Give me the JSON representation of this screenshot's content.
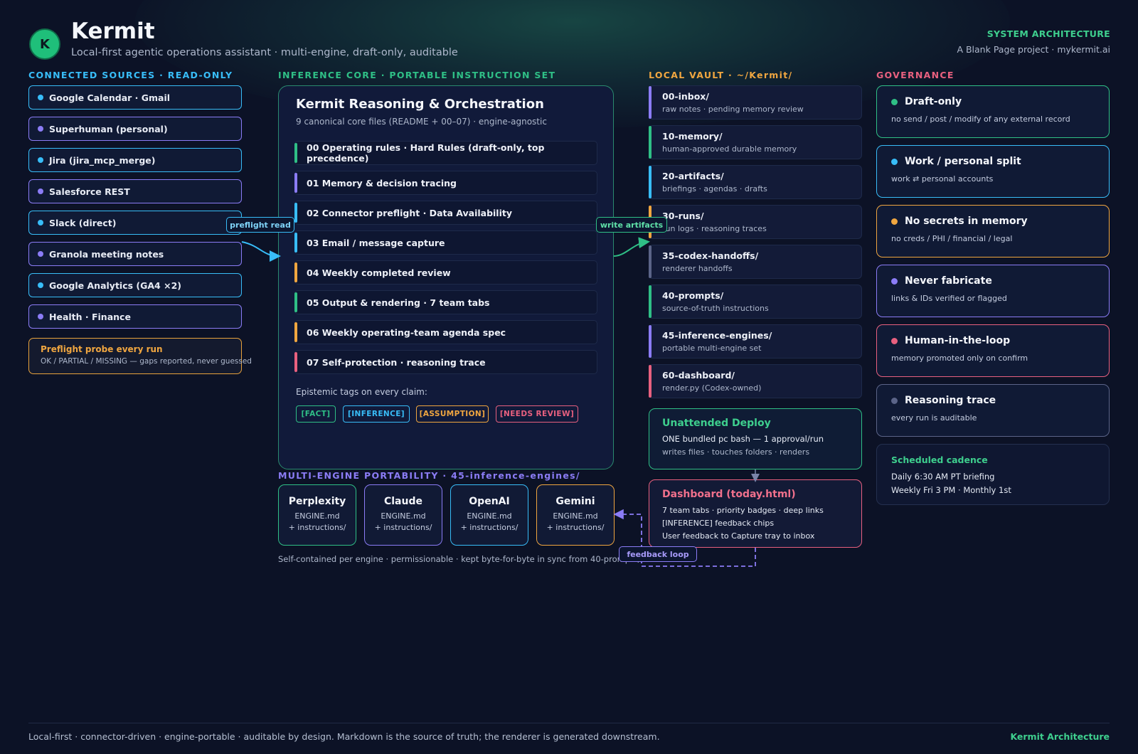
{
  "header": {
    "logo_letter": "K",
    "title": "Kermit",
    "subtitle": "Local-first agentic operations assistant · multi-engine, draft-only, auditable",
    "tag": "SYSTEM ARCHITECTURE",
    "project": "A Blank Page project · mykermit.ai"
  },
  "sources": {
    "title": "CONNECTED SOURCES · READ-ONLY",
    "items": [
      {
        "label": "Google Calendar · Gmail",
        "color": "#38bdf8"
      },
      {
        "label": "Superhuman (personal)",
        "color": "#8b7cf6"
      },
      {
        "label": "Jira (jira_mcp_merge)",
        "color": "#38bdf8"
      },
      {
        "label": "Salesforce REST",
        "color": "#8b7cf6"
      },
      {
        "label": "Slack (direct)",
        "color": "#38bdf8"
      },
      {
        "label": "Granola meeting notes",
        "color": "#8b7cf6"
      },
      {
        "label": "Google Analytics (GA4 ×2)",
        "color": "#38bdf8"
      },
      {
        "label": "Health · Finance",
        "color": "#8b7cf6"
      }
    ],
    "preflight": {
      "title": "Preflight probe every run",
      "text": "OK / PARTIAL / MISSING — gaps reported, never guessed"
    }
  },
  "core": {
    "section_title": "INFERENCE CORE · PORTABLE INSTRUCTION SET",
    "title": "Kermit Reasoning & Orchestration",
    "subtitle": "9 canonical core files (README + 00–07) · engine-agnostic",
    "rules": [
      {
        "label": "00 Operating rules · Hard Rules (draft-only, top precedence)",
        "color": "#2fbf86"
      },
      {
        "label": "01 Memory & decision tracing",
        "color": "#8b7cf6"
      },
      {
        "label": "02 Connector preflight · Data Availability",
        "color": "#38bdf8"
      },
      {
        "label": "03 Email / message capture",
        "color": "#38bdf8"
      },
      {
        "label": "04 Weekly completed review",
        "color": "#f0a640"
      },
      {
        "label": "05 Output & rendering · 7 team tabs",
        "color": "#2fbf86"
      },
      {
        "label": "06 Weekly operating-team agenda spec",
        "color": "#f0a640"
      },
      {
        "label": "07 Self-protection · reasoning trace",
        "color": "#e8607f"
      }
    ],
    "epistemic_label": "Epistemic tags on every claim:",
    "tags": [
      {
        "label": "[FACT]",
        "color": "#2fbf86"
      },
      {
        "label": "[INFERENCE]",
        "color": "#38bdf8"
      },
      {
        "label": "[ASSUMPTION]",
        "color": "#f0a640"
      },
      {
        "label": "[NEEDS REVIEW]",
        "color": "#e8607f"
      }
    ]
  },
  "engines": {
    "title": "MULTI-ENGINE PORTABILITY · 45-inference-engines/",
    "items": [
      {
        "name": "Perplexity",
        "file": "ENGINE.md",
        "inst": "+ instructions/",
        "color": "#2fbf86"
      },
      {
        "name": "Claude",
        "file": "ENGINE.md",
        "inst": "+ instructions/",
        "color": "#8b7cf6"
      },
      {
        "name": "OpenAI",
        "file": "ENGINE.md",
        "inst": "+ instructions/",
        "color": "#38bdf8"
      },
      {
        "name": "Gemini",
        "file": "ENGINE.md",
        "inst": "+ instructions/",
        "color": "#f0a640"
      }
    ],
    "note": "Self-contained per engine · permissionable · kept byte-for-byte in sync from 40-prompts/"
  },
  "vault": {
    "title": "LOCAL VAULT · ~/Kermit/",
    "items": [
      {
        "name": "00-inbox/",
        "desc": "raw notes · pending memory review",
        "color": "#8b7cf6"
      },
      {
        "name": "10-memory/",
        "desc": "human-approved durable memory",
        "color": "#2fbf86"
      },
      {
        "name": "20-artifacts/",
        "desc": "briefings · agendas · drafts",
        "color": "#38bdf8"
      },
      {
        "name": "30-runs/",
        "desc": "run logs · reasoning traces",
        "color": "#f0a640"
      },
      {
        "name": "35-codex-handoffs/",
        "desc": "renderer handoffs",
        "color": "#5b6488"
      },
      {
        "name": "40-prompts/",
        "desc": "source-of-truth instructions",
        "color": "#2fbf86"
      },
      {
        "name": "45-inference-engines/",
        "desc": "portable multi-engine set",
        "color": "#8b7cf6"
      },
      {
        "name": "60-dashboard/",
        "desc": "render.py (Codex-owned)",
        "color": "#e8607f"
      }
    ],
    "deploy": {
      "title": "Unattended Deploy",
      "line1": "ONE bundled pc bash — 1 approval/run",
      "line2": "writes files · touches folders · renders"
    },
    "dashboard": {
      "title": "Dashboard (today.html)",
      "line1": "7 team tabs · priority badges · deep links",
      "line2": "[INFERENCE] feedback chips",
      "line3": "User feedback to Capture tray to inbox"
    }
  },
  "governance": {
    "title": "GOVERNANCE",
    "items": [
      {
        "title": "Draft-only",
        "desc": "no send / post / modify of any external record",
        "color": "#2fbf86"
      },
      {
        "title": "Work / personal split",
        "desc": "work ⇄ personal accounts",
        "color": "#38bdf8"
      },
      {
        "title": "No secrets in memory",
        "desc": "no creds / PHI / financial / legal",
        "color": "#f0a640"
      },
      {
        "title": "Never fabricate",
        "desc": "links & IDs verified or flagged",
        "color": "#8b7cf6"
      },
      {
        "title": "Human-in-the-loop",
        "desc": "memory promoted only on confirm",
        "color": "#e8607f"
      },
      {
        "title": "Reasoning trace",
        "desc": "every run is auditable",
        "color": "#5b6488"
      }
    ],
    "cadence": {
      "title": "Scheduled cadence",
      "line1": "Daily 6:30 AM PT briefing",
      "line2": "Weekly Fri 3 PM · Monthly 1st"
    }
  },
  "connectors": {
    "preflight_read": "preflight read",
    "write_artifacts": "write artifacts",
    "feedback_loop": "feedback loop"
  },
  "footer": {
    "text": "Local-first · connector-driven · engine-portable · auditable by design. Markdown is the source of truth; the renderer is generated downstream.",
    "brand": "Kermit Architecture"
  }
}
